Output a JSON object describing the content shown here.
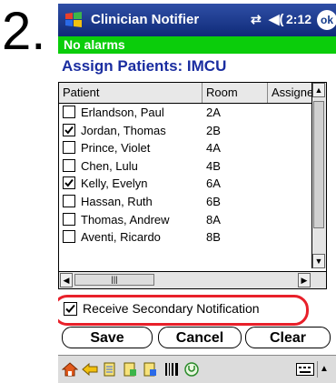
{
  "step_number": "2.",
  "titlebar": {
    "app_title": "Clinician Notifier",
    "time": "2:12",
    "ok_label": "ok",
    "signal_glyph": "⇄",
    "volume_glyph": "◀("
  },
  "alarm_bar": {
    "text": "No alarms",
    "color": "#0bcd0b"
  },
  "section_title": "Assign Patients: IMCU",
  "table": {
    "columns": [
      "Patient",
      "Room",
      "Assigne"
    ],
    "rows": [
      {
        "checked": false,
        "patient": "Erlandson, Paul",
        "room": "2A"
      },
      {
        "checked": true,
        "patient": "Jordan, Thomas",
        "room": "2B"
      },
      {
        "checked": false,
        "patient": "Prince, Violet",
        "room": "4A"
      },
      {
        "checked": false,
        "patient": "Chen, Lulu",
        "room": "4B"
      },
      {
        "checked": true,
        "patient": "Kelly, Evelyn",
        "room": "6A"
      },
      {
        "checked": false,
        "patient": "Hassan, Ruth",
        "room": "6B"
      },
      {
        "checked": false,
        "patient": "Thomas, Andrew",
        "room": "8A"
      },
      {
        "checked": false,
        "patient": "Aventi, Ricardo",
        "room": "8B"
      }
    ]
  },
  "secondary_notification": {
    "label": "Receive Secondary Notification",
    "checked": true,
    "highlight_color": "#e8202a"
  },
  "buttons": {
    "save": "Save",
    "cancel": "Cancel",
    "clear": "Clear"
  },
  "taskbar": {
    "icons": [
      "home-icon",
      "back-arrow-icon",
      "note-icon",
      "note-add-icon",
      "note-edit-icon",
      "barcode-icon",
      "stethoscope-icon",
      "keyboard-icon"
    ]
  },
  "colors": {
    "title_bg": "#1a3a8c",
    "section_title": "#1a2da0"
  }
}
